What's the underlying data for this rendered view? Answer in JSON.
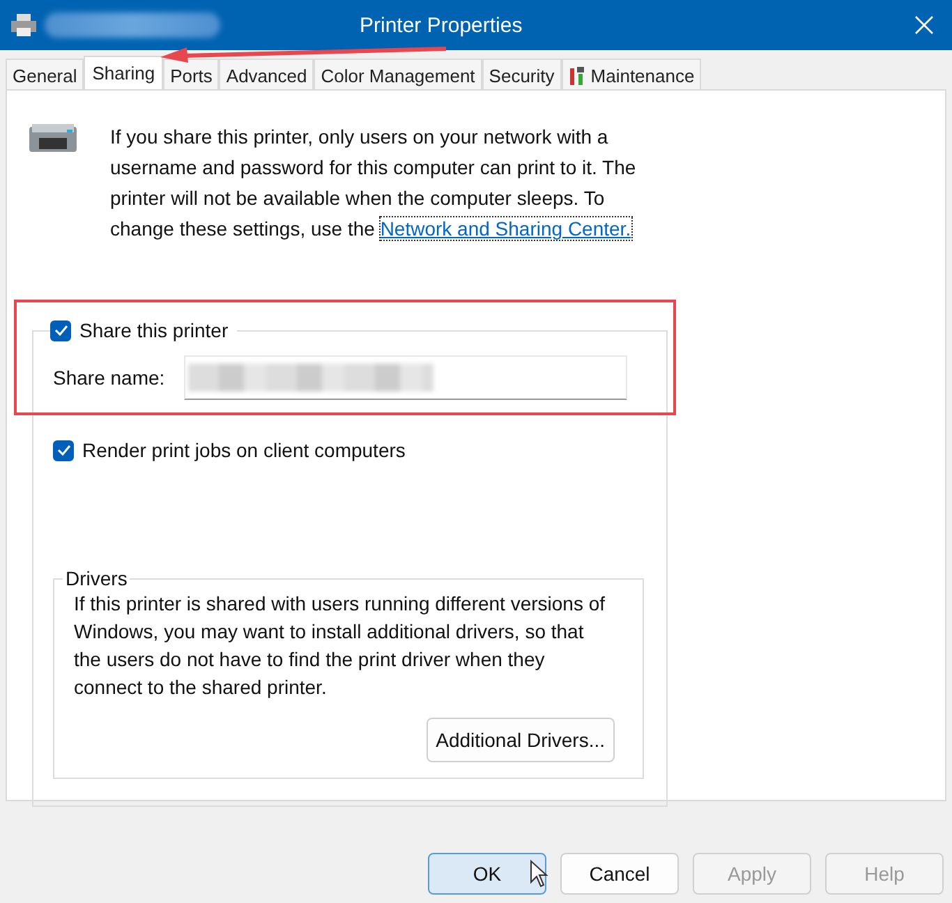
{
  "window": {
    "title": "Printer Properties"
  },
  "tabs": [
    {
      "label": "General",
      "selected": false
    },
    {
      "label": "Sharing",
      "selected": true
    },
    {
      "label": "Ports",
      "selected": false
    },
    {
      "label": "Advanced",
      "selected": false
    },
    {
      "label": "Color Management",
      "selected": false
    },
    {
      "label": "Security",
      "selected": false
    },
    {
      "label": "Maintenance",
      "selected": false,
      "icon": true
    }
  ],
  "intro": {
    "text": "If you share this printer, only users on your network with a username and password for this computer can print to it. The printer will not be available when the computer sleeps. To change these settings, use the",
    "link": "Network and Sharing Center."
  },
  "share": {
    "label": "Share this printer",
    "checked": true,
    "name_label": "Share name:"
  },
  "render": {
    "label": "Render print jobs on client computers",
    "checked": true
  },
  "drivers": {
    "title": "Drivers",
    "text": "If this printer is shared with users running different versions of Windows, you may want to install additional drivers, so that the users do not have to find the print driver when they connect to the shared printer.",
    "button": "Additional Drivers..."
  },
  "buttons": [
    {
      "label": "OK",
      "kind": "default",
      "disabled": false
    },
    {
      "label": "Cancel",
      "kind": "normal",
      "disabled": false
    },
    {
      "label": "Apply",
      "kind": "normal",
      "disabled": true
    },
    {
      "label": "Help",
      "kind": "normal",
      "disabled": true
    }
  ]
}
